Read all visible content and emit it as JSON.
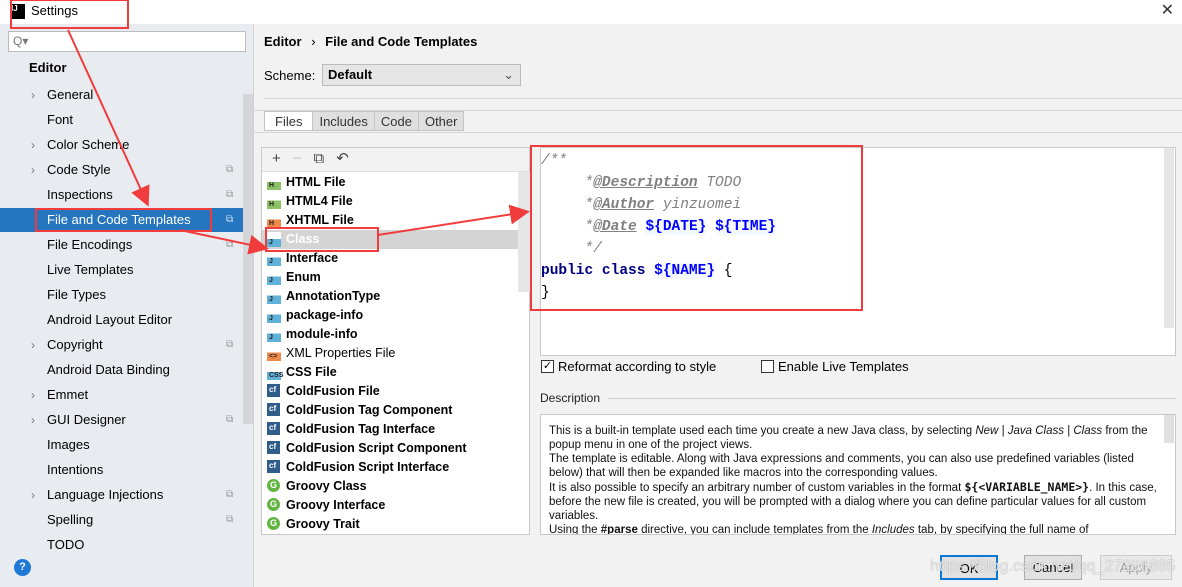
{
  "window": {
    "title": "Settings",
    "app_icon": "IJ",
    "close": "✕"
  },
  "sidebar": {
    "search_placeholder": "Q▾",
    "section": "Editor",
    "items": [
      {
        "label": "General",
        "chevron": true,
        "copy": false
      },
      {
        "label": "Font",
        "chevron": false,
        "copy": false
      },
      {
        "label": "Color Scheme",
        "chevron": true,
        "copy": false
      },
      {
        "label": "Code Style",
        "chevron": true,
        "copy": true
      },
      {
        "label": "Inspections",
        "chevron": false,
        "copy": true
      },
      {
        "label": "File and Code Templates",
        "chevron": false,
        "copy": true,
        "selected": true
      },
      {
        "label": "File Encodings",
        "chevron": false,
        "copy": true
      },
      {
        "label": "Live Templates",
        "chevron": false,
        "copy": false
      },
      {
        "label": "File Types",
        "chevron": false,
        "copy": false
      },
      {
        "label": "Android Layout Editor",
        "chevron": false,
        "copy": false
      },
      {
        "label": "Copyright",
        "chevron": true,
        "copy": true
      },
      {
        "label": "Android Data Binding",
        "chevron": false,
        "copy": false
      },
      {
        "label": "Emmet",
        "chevron": true,
        "copy": false
      },
      {
        "label": "GUI Designer",
        "chevron": true,
        "copy": true
      },
      {
        "label": "Images",
        "chevron": false,
        "copy": false
      },
      {
        "label": "Intentions",
        "chevron": false,
        "copy": false
      },
      {
        "label": "Language Injections",
        "chevron": true,
        "copy": true
      },
      {
        "label": "Spelling",
        "chevron": false,
        "copy": true
      },
      {
        "label": "TODO",
        "chevron": false,
        "copy": false
      }
    ],
    "help": "?"
  },
  "breadcrumb": {
    "parent": "Editor",
    "separator": "›",
    "current": "File and Code Templates"
  },
  "scheme": {
    "label": "Scheme:",
    "value": "Default"
  },
  "tabs": [
    {
      "label": "Files",
      "active": true
    },
    {
      "label": "Includes"
    },
    {
      "label": "Code"
    },
    {
      "label": "Other"
    }
  ],
  "toolbar": {
    "add": "+",
    "remove": "−",
    "copy": "⧉",
    "reset": "↶"
  },
  "files": [
    {
      "name": "HTML File",
      "icon": "H",
      "color": "#8cc265"
    },
    {
      "name": "HTML4 File",
      "icon": "H",
      "color": "#8cc265"
    },
    {
      "name": "XHTML File",
      "icon": "H",
      "color": "#f08a4b"
    },
    {
      "name": "Class",
      "icon": "J",
      "color": "#5fb1da",
      "selected": true
    },
    {
      "name": "Interface",
      "icon": "J",
      "color": "#5fb1da"
    },
    {
      "name": "Enum",
      "icon": "J",
      "color": "#5fb1da"
    },
    {
      "name": "AnnotationType",
      "icon": "J",
      "color": "#5fb1da"
    },
    {
      "name": "package-info",
      "icon": "J",
      "color": "#5fb1da"
    },
    {
      "name": "module-info",
      "icon": "J",
      "color": "#5fb1da"
    },
    {
      "name": "XML Properties File",
      "icon": "<>",
      "color": "#f08a4b",
      "normal": true
    },
    {
      "name": "CSS File",
      "icon": "CSS",
      "color": "#5fb1da"
    },
    {
      "name": "ColdFusion File",
      "icon": "cf",
      "color": "#2f5d8a"
    },
    {
      "name": "ColdFusion Tag Component",
      "icon": "cf",
      "color": "#2f5d8a"
    },
    {
      "name": "ColdFusion Tag Interface",
      "icon": "cf",
      "color": "#2f5d8a"
    },
    {
      "name": "ColdFusion Script Component",
      "icon": "cf",
      "color": "#2f5d8a"
    },
    {
      "name": "ColdFusion Script Interface",
      "icon": "cf",
      "color": "#2f5d8a"
    },
    {
      "name": "Groovy Class",
      "icon": "G",
      "color": "#62b543"
    },
    {
      "name": "Groovy Interface",
      "icon": "G",
      "color": "#62b543"
    },
    {
      "name": "Groovy Trait",
      "icon": "G",
      "color": "#62b543"
    }
  ],
  "code": {
    "l1": "/**",
    "l2a": "     *",
    "l2tag": "@Description",
    "l2b": " TODO",
    "l3a": "     *",
    "l3tag": "@Author",
    "l3b": " yinzuomei",
    "l4a": "     *",
    "l4tag": "@Date",
    "l4v1": "${DATE}",
    "l4v2": "${TIME}",
    "l5": "     */",
    "l6kw": "public class ",
    "l6v": "${NAME}",
    "l6b": " {",
    "l7": "}"
  },
  "options": {
    "reformat": {
      "label": "Reformat according to style",
      "checked": true
    },
    "live": {
      "label": "Enable Live Templates",
      "checked": false
    }
  },
  "description": {
    "label": "Description",
    "p1a": "This is a built-in template used each time you create a new Java class, by selecting ",
    "p1i": "New | Java Class | Class",
    "p1b": " from the popup menu in one of the project views.",
    "p2": "The template is editable. Along with Java expressions and comments, you can also use predefined variables (listed below) that will then be expanded like macros into the corresponding values.",
    "p3a": "It is also possible to specify an arbitrary number of custom variables in the format ",
    "p3b": "${<VARIABLE_NAME>}",
    "p3c": ". In this case, before the new file is created, you will be prompted with a dialog where you can define particular values for all custom variables.",
    "p4a": "Using the ",
    "p4b": "#parse",
    "p4c": " directive, you can include templates from the ",
    "p4i": "Includes",
    "p4d": " tab, by specifying the full name of"
  },
  "buttons": {
    "ok": "OK",
    "cancel": "Cancel",
    "apply": "Apply"
  },
  "watermark": "https://blog.csdn.net/qq_27296885",
  "colors": {
    "selection": "#2675bf",
    "annotation": "#f03c3c",
    "ok_border": "#0a78d7"
  }
}
